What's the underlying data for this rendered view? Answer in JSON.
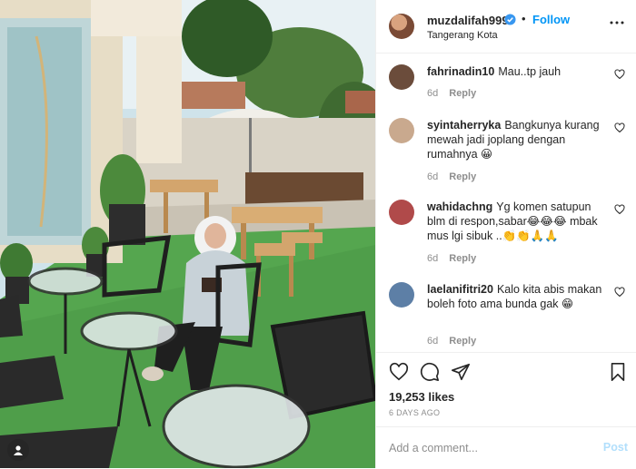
{
  "post": {
    "username": "muzdalifah999",
    "verified": true,
    "separator": "•",
    "follow_label": "Follow",
    "location": "Tangerang Kota"
  },
  "comments": [
    {
      "user": "fahrinadin10",
      "text": "Mau..tp jauh",
      "age": "6d",
      "reply_label": "Reply",
      "avatar_color": "#6b4c3b"
    },
    {
      "user": "syintaherryka",
      "text": "Bangkunya kurang mewah jadi joplang dengan rumahnya 😀",
      "age": "6d",
      "reply_label": "Reply",
      "avatar_color": "#c9a98e"
    },
    {
      "user": "wahidachng",
      "text": "Yg komen satupun blm di respon,sabar😂😂😂 mbak mus lgi sibuk ..👏👏🙏🙏",
      "age": "6d",
      "reply_label": "Reply",
      "avatar_color": "#b04a4a"
    },
    {
      "user": "laelanifitri20",
      "text": "Kalo kita abis makan boleh foto ama bunda gak 😁",
      "age": "6d",
      "reply_label": "Reply",
      "avatar_color": "#5d7fa6"
    }
  ],
  "stats": {
    "likes": "19,253 likes",
    "time_ago": "6 DAYS AGO"
  },
  "composer": {
    "placeholder": "Add a comment...",
    "post_label": "Post"
  },
  "colors": {
    "link_blue": "#0095f6",
    "muted": "#8e8e8e",
    "post_disabled": "#b2dffc",
    "grass": "#4f9e4a"
  }
}
